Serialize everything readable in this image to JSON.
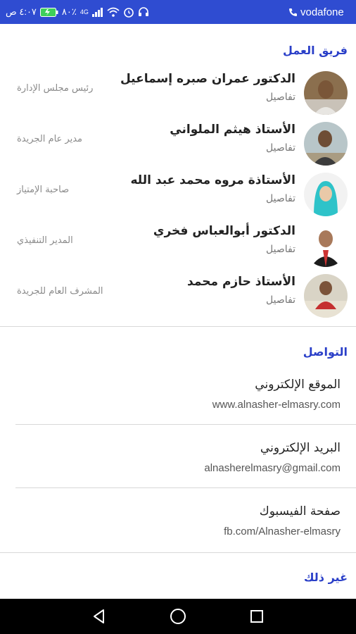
{
  "status_bar": {
    "carrier": "vodafone",
    "time": "٤:٠٧ ص",
    "battery_level": "٨٠٪",
    "network": "4G"
  },
  "team": {
    "title": "فريق العمل",
    "members": [
      {
        "name": "الدكتور عمران صبره إسماعيل",
        "details": "تفاصيل",
        "role": "رئيس مجلس الإدارة"
      },
      {
        "name": "الأستاذ هيثم الملواني",
        "details": "تفاصيل",
        "role": "مدير عام الجريدة"
      },
      {
        "name": "الأستاذة مروه محمد عبد الله",
        "details": "تفاصيل",
        "role": "صاحبة الإمتياز"
      },
      {
        "name": "الدكتور أبوالعباس فخري",
        "details": "تفاصيل",
        "role": "المدير التنفيذي"
      },
      {
        "name": "الأستاذ حازم محمد",
        "details": "تفاصيل",
        "role": "المشرف العام للجريدة"
      }
    ]
  },
  "contact": {
    "title": "التواصل",
    "items": [
      {
        "label": "الموقع الإلكتروني",
        "value": "www.alnasher-elmasry.com"
      },
      {
        "label": "البريد الإلكتروني",
        "value": "alnasherelmasry@gmail.com"
      },
      {
        "label": "صفحة الفيسبوك",
        "value": "fb.com/Alnasher-elmasry"
      }
    ]
  },
  "other": {
    "title": "غير ذلك"
  }
}
